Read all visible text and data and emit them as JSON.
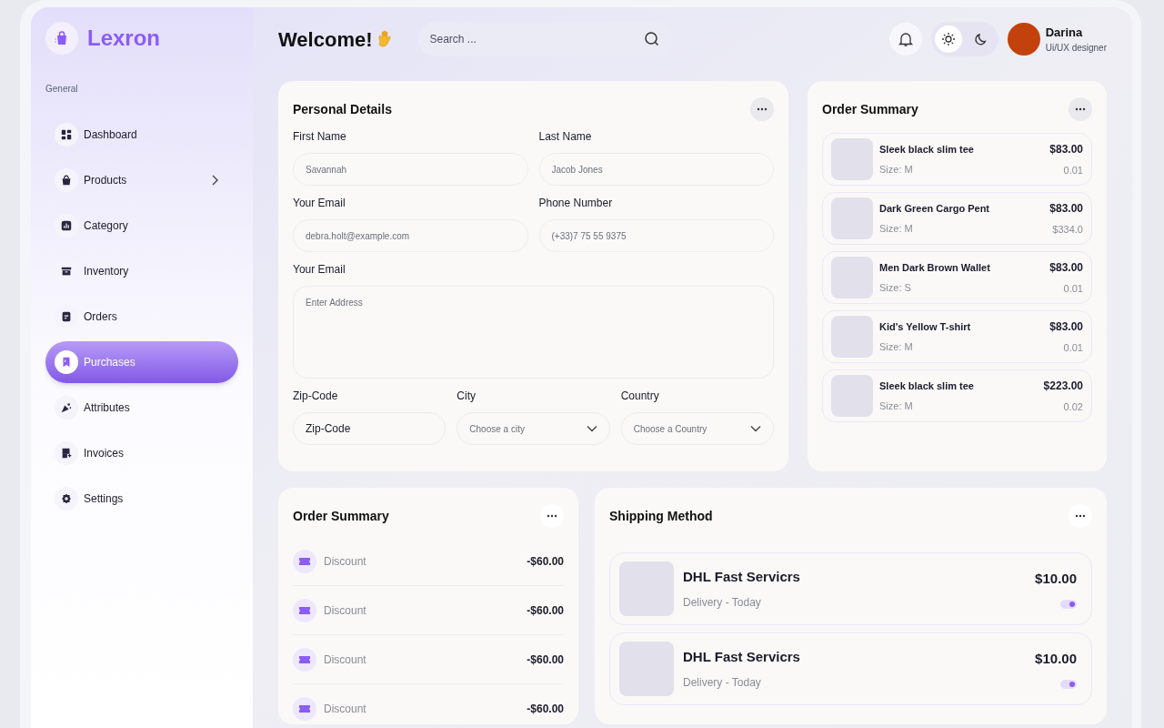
{
  "brand": {
    "name": "Lexron"
  },
  "sidebar": {
    "section": "General",
    "items": [
      {
        "label": "Dashboard",
        "selected": false,
        "has_submenu": false
      },
      {
        "label": "Products",
        "selected": false,
        "has_submenu": true
      },
      {
        "label": "Category",
        "selected": false,
        "has_submenu": false
      },
      {
        "label": "Inventory",
        "selected": false,
        "has_submenu": false
      },
      {
        "label": "Orders",
        "selected": false,
        "has_submenu": false
      },
      {
        "label": "Purchases",
        "selected": true,
        "has_submenu": false
      },
      {
        "label": "Attributes",
        "selected": false,
        "has_submenu": false
      },
      {
        "label": "Invoices",
        "selected": false,
        "has_submenu": false
      },
      {
        "label": "Settings",
        "selected": false,
        "has_submenu": false
      }
    ]
  },
  "header": {
    "title": "Welcome!",
    "search": {
      "placeholder": "Search ..."
    },
    "theme_modes": [
      {
        "kind": "light",
        "selected": true
      },
      {
        "kind": "dark",
        "selected": false
      }
    ],
    "user": {
      "name": "Darina",
      "role": "Ui/UX designer"
    }
  },
  "personal_details": {
    "title": "Personal Details",
    "rows": [
      [
        {
          "kind": "input",
          "label": "First Name",
          "placeholder": "Savannah"
        },
        {
          "kind": "input",
          "label": "Last Name",
          "placeholder": "Jacob Jones"
        }
      ],
      [
        {
          "kind": "input",
          "label": "Your Email",
          "placeholder": "debra.holt@example.com"
        },
        {
          "kind": "input",
          "label": "Phone Number",
          "placeholder": "(+33)7 75 55 9375"
        }
      ],
      [
        {
          "kind": "textarea",
          "label": "Your Email",
          "placeholder": "Enter Address"
        }
      ],
      [
        {
          "kind": "input",
          "label": "Zip-Code",
          "value": "Zip-Code"
        },
        {
          "kind": "select",
          "label": "City",
          "placeholder": "Choose a city"
        },
        {
          "kind": "select",
          "label": "Country",
          "placeholder": "Choose a Country"
        }
      ]
    ]
  },
  "order_summary": {
    "title": "Order Summary",
    "items": [
      {
        "name": "Sleek black slim tee",
        "size": "Size: M",
        "price": "$83.00",
        "subtotal": "0.01"
      },
      {
        "name": "Dark Green Cargo Pent",
        "size": "Size: M",
        "price": "$83.00",
        "subtotal": "$334.0"
      },
      {
        "name": "Men Dark Brown Wallet",
        "size": "Size: S",
        "price": "$83.00",
        "subtotal": "0.01"
      },
      {
        "name": "Kid's Yellow T-shirt",
        "size": "Size: M",
        "price": "$83.00",
        "subtotal": "0.01"
      },
      {
        "name": "Sleek black slim tee",
        "size": "Size: M",
        "price": "$223.00",
        "subtotal": "0.02"
      }
    ]
  },
  "discount_summary": {
    "title": "Order Summary",
    "rows": [
      {
        "label": "Discount",
        "amount": "-$60.00"
      },
      {
        "label": "Discount",
        "amount": "-$60.00"
      },
      {
        "label": "Discount",
        "amount": "-$60.00"
      },
      {
        "label": "Discount",
        "amount": "-$60.00"
      }
    ]
  },
  "shipping_method": {
    "title": "Shipping Method",
    "options": [
      {
        "name": "DHL Fast Servicrs",
        "delivery": "Delivery - Today",
        "price": "$10.00",
        "on": true
      },
      {
        "name": "DHL Fast Servicrs",
        "delivery": "Delivery - Today",
        "price": "$10.00",
        "on": true
      }
    ]
  }
}
